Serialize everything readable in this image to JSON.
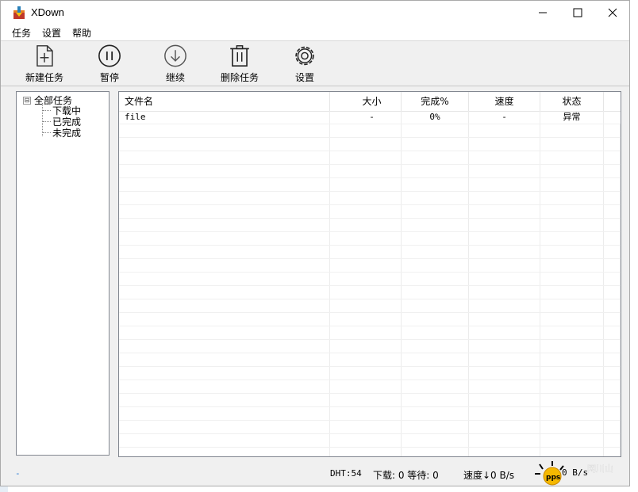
{
  "window": {
    "title": "XDown"
  },
  "menu": [
    "任务",
    "设置",
    "帮助"
  ],
  "toolbar": [
    {
      "label": "新建任务",
      "icon": "new-task-icon"
    },
    {
      "label": "暂停",
      "icon": "pause-icon"
    },
    {
      "label": "继续",
      "icon": "resume-icon"
    },
    {
      "label": "删除任务",
      "icon": "trash-icon"
    },
    {
      "label": "设置",
      "icon": "gear-icon"
    }
  ],
  "tree": {
    "root": "全部任务",
    "toggle": "⊟",
    "children": [
      "下载中",
      "已完成",
      "未完成"
    ]
  },
  "list": {
    "columns": [
      "文件名",
      "大小",
      "完成%",
      "速度",
      "状态"
    ],
    "rows": [
      {
        "name": "file",
        "size": "-",
        "percent": "0%",
        "speed": "-",
        "status": "异常"
      }
    ]
  },
  "status": {
    "left": "-",
    "dht": "DHT:54",
    "download": "下载: 0 等待: 0",
    "speed": "速度↓0 B/s",
    "speed2": "0 B/s"
  },
  "colors": {
    "accent": "#1e74d6",
    "border": "#828790"
  }
}
